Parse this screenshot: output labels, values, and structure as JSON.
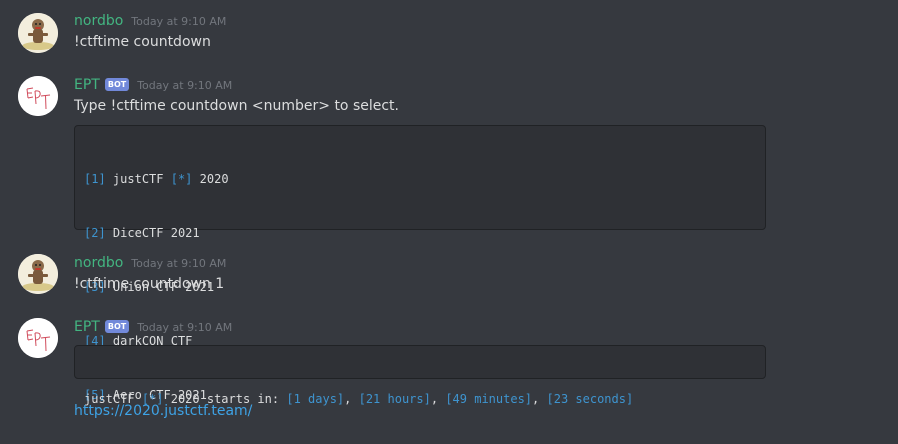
{
  "messages": [
    {
      "username": "nordbo",
      "timestamp": "Today at 9:10 AM",
      "text": "!ctftime countdown"
    },
    {
      "username": "EPT",
      "bot_tag": "BOT",
      "timestamp": "Today at 9:10 AM",
      "text": "Type !ctftime countdown <number> to select.",
      "code_lines": [
        {
          "index": "[1]",
          "name": "justCTF",
          "star": "[*]",
          "rest": "2020"
        },
        {
          "index": "[2]",
          "name": "DiceCTF 2021",
          "star": "",
          "rest": ""
        },
        {
          "index": "[3]",
          "name": "Union CTF 2021",
          "star": "",
          "rest": ""
        },
        {
          "index": "[4]",
          "name": "darkCON CTF",
          "star": "",
          "rest": ""
        },
        {
          "index": "[5]",
          "name": "Aero CTF 2021",
          "star": "",
          "rest": ""
        }
      ]
    },
    {
      "username": "nordbo",
      "timestamp": "Today at 9:10 AM",
      "text": "!ctftime countdown 1"
    },
    {
      "username": "EPT",
      "bot_tag": "BOT",
      "timestamp": "Today at 9:10 AM",
      "countdown": {
        "name": "justCTF",
        "star": "[*]",
        "prefix": "2020 starts in:",
        "days": "[1 days]",
        "hours": "[21 hours]",
        "minutes": "[49 minutes]",
        "seconds": "[23 seconds]",
        "sep": ","
      },
      "link": "https://2020.justctf.team/"
    }
  ],
  "colors": {
    "background": "#36393f",
    "username": "#43b581",
    "bot_tag": "#7289da",
    "code_highlight": "#3e94cf",
    "link": "#3ea3e6"
  }
}
